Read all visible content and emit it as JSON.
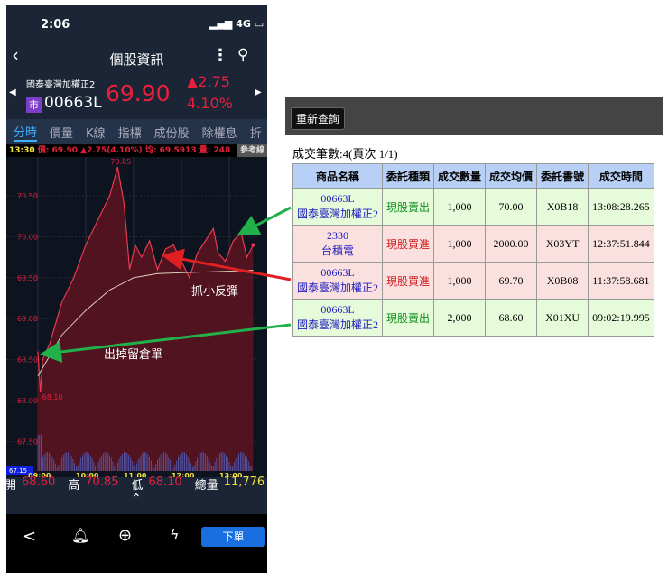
{
  "status": {
    "time": "2:06",
    "network": "4G"
  },
  "header": {
    "title": "個股資訊"
  },
  "stock": {
    "name": "國泰臺灣加權正2",
    "market_badge": "市",
    "code": "00663L",
    "price": "69.90",
    "change": "▲2.75",
    "change_pct": "4.10%"
  },
  "tabs": [
    "分時",
    "價量",
    "K線",
    "指標",
    "成份股",
    "除權息",
    "折"
  ],
  "infobar": {
    "time": "13:30",
    "price": "價: 69.90 ▲2.75(4.10%)",
    "avg": "均: 69.5913",
    "vol": "量: 248",
    "ref_button": "參考線"
  },
  "chart_data": {
    "type": "line",
    "title": "",
    "high_label": "70.85",
    "low_label": "68.10",
    "last_label": "67.15",
    "y_ticks": [
      "70.50",
      "70.00",
      "69.50",
      "69.00",
      "68.50",
      "68.00",
      "67.50"
    ],
    "x_ticks": [
      "09:00",
      "10:00",
      "11:00",
      "12:00",
      "13:00"
    ],
    "ylim": [
      67.15,
      70.95
    ],
    "price": [
      [
        0,
        68.6
      ],
      [
        3,
        68.1
      ],
      [
        6,
        68.5
      ],
      [
        15,
        68.7
      ],
      [
        30,
        69.2
      ],
      [
        45,
        69.5
      ],
      [
        60,
        69.9
      ],
      [
        75,
        70.2
      ],
      [
        90,
        70.5
      ],
      [
        100,
        70.85
      ],
      [
        108,
        70.4
      ],
      [
        115,
        69.6
      ],
      [
        122,
        69.9
      ],
      [
        130,
        69.75
      ],
      [
        140,
        69.95
      ],
      [
        150,
        69.6
      ],
      [
        160,
        69.85
      ],
      [
        170,
        69.9
      ],
      [
        180,
        69.7
      ],
      [
        190,
        69.5
      ],
      [
        200,
        69.8
      ],
      [
        210,
        69.95
      ],
      [
        220,
        70.1
      ],
      [
        226,
        69.8
      ],
      [
        235,
        69.7
      ],
      [
        245,
        69.95
      ],
      [
        255,
        70.05
      ],
      [
        262,
        69.75
      ],
      [
        270,
        69.9
      ]
    ],
    "avg": [
      [
        0,
        68.3
      ],
      [
        30,
        68.8
      ],
      [
        60,
        69.1
      ],
      [
        90,
        69.35
      ],
      [
        120,
        69.5
      ],
      [
        150,
        69.55
      ],
      [
        180,
        69.56
      ],
      [
        210,
        69.57
      ],
      [
        240,
        69.58
      ],
      [
        270,
        69.59
      ]
    ]
  },
  "annotations": {
    "buy": "抓小反彈",
    "sell": "出掉留倉單"
  },
  "summary": {
    "open_label": "開",
    "open": "68.60",
    "high_label": "高",
    "high": "70.85",
    "low_label": "低",
    "low": "68.10",
    "vol_label": "總量",
    "vol": "11,776"
  },
  "toolbar": {
    "order": "下單"
  },
  "trades": {
    "refresh": "重新查詢",
    "count": "成交筆數:4(頁次 1/1)",
    "headers": [
      "商品名稱",
      "委託種類",
      "成交數量",
      "成交均價",
      "委託書號",
      "成交時間"
    ],
    "rows": [
      {
        "code": "00663L",
        "name": "國泰臺灣加權正2",
        "type": "現股賣出",
        "qty": "1,000",
        "price": "70.00",
        "order": "X0B18",
        "time": "13:08:28.265"
      },
      {
        "code": "2330",
        "name": "台積電",
        "type": "現股買進",
        "qty": "1,000",
        "price": "2000.00",
        "order": "X03YT",
        "time": "12:37:51.844"
      },
      {
        "code": "00663L",
        "name": "國泰臺灣加權正2",
        "type": "現股買進",
        "qty": "1,000",
        "price": "69.70",
        "order": "X0B08",
        "time": "11:37:58.681"
      },
      {
        "code": "00663L",
        "name": "國泰臺灣加權正2",
        "type": "現股賣出",
        "qty": "2,000",
        "price": "68.60",
        "order": "X01XU",
        "time": "09:02:19.995"
      }
    ]
  }
}
